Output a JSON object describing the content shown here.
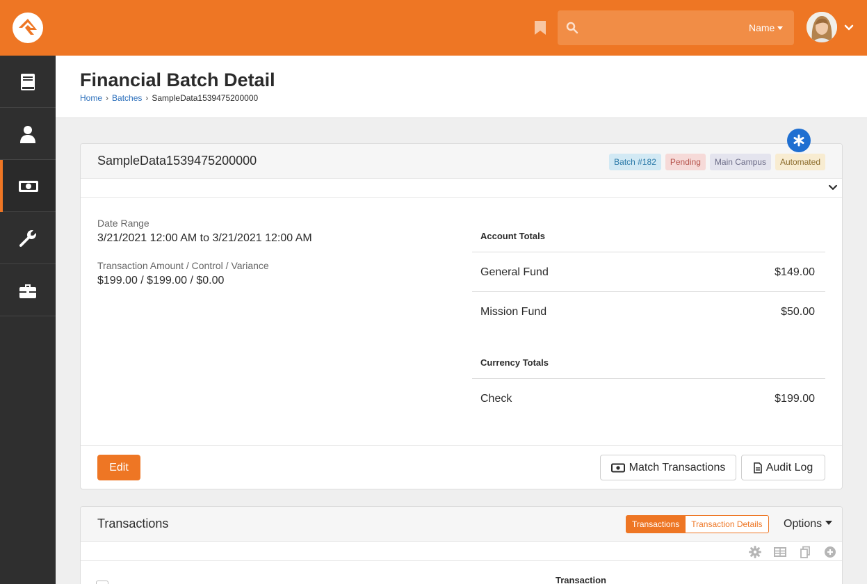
{
  "header": {
    "search": {
      "placeholder": "",
      "filter_label": "Name"
    }
  },
  "sidebar": {
    "items": [
      {
        "icon": "book-icon"
      },
      {
        "icon": "person-icon"
      },
      {
        "icon": "money-icon",
        "active": true
      },
      {
        "icon": "wrench-icon"
      },
      {
        "icon": "briefcase-icon"
      }
    ]
  },
  "page": {
    "title": "Financial Batch Detail",
    "breadcrumb": [
      "Home",
      "Batches",
      "SampleData1539475200000"
    ]
  },
  "batch_panel": {
    "title": "SampleData1539475200000",
    "labels": [
      "Batch #182",
      "Pending",
      "Main Campus",
      "Automated"
    ],
    "date_range_label": "Date Range",
    "date_range_value": "3/21/2021 12:00 AM to 3/21/2021 12:00 AM",
    "amount_label": "Transaction Amount / Control / Variance",
    "amount_value": "$199.00 / $199.00 / $0.00",
    "account_totals_heading": "Account Totals",
    "account_totals": [
      {
        "name": "General Fund",
        "amount": "$149.00"
      },
      {
        "name": "Mission Fund",
        "amount": "$50.00"
      }
    ],
    "currency_totals_heading": "Currency Totals",
    "currency_totals": [
      {
        "name": "Check",
        "amount": "$199.00"
      }
    ],
    "edit_label": "Edit",
    "match_label": "Match Transactions",
    "audit_label": "Audit Log"
  },
  "transactions_panel": {
    "title": "Transactions",
    "toggle_on": "Transactions",
    "toggle_off": "Transaction Details",
    "options_label": "Options",
    "column_header": "Transaction"
  },
  "colors": {
    "brand": "#ee7624",
    "sidebar": "#2f2f2f",
    "link": "#2a6ebb",
    "fab": "#1f6fd1"
  }
}
